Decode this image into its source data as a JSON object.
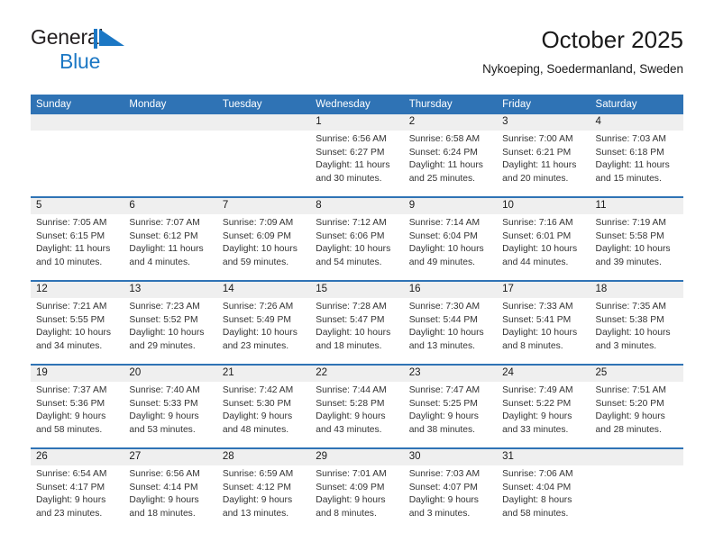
{
  "brand": {
    "name_top": "General",
    "name_bottom": "Blue",
    "flag_icon": "blue-triangle-flag",
    "accent_color": "#1b77c4"
  },
  "header": {
    "title": "October 2025",
    "subtitle": "Nykoeping, Soedermanland, Sweden"
  },
  "calendar": {
    "header_bg": "#2f73b5",
    "daynum_bg": "#efefef",
    "weekdays": [
      "Sunday",
      "Monday",
      "Tuesday",
      "Wednesday",
      "Thursday",
      "Friday",
      "Saturday"
    ],
    "weeks": [
      [
        {
          "day": "",
          "lines": []
        },
        {
          "day": "",
          "lines": []
        },
        {
          "day": "",
          "lines": []
        },
        {
          "day": "1",
          "lines": [
            "Sunrise: 6:56 AM",
            "Sunset: 6:27 PM",
            "Daylight: 11 hours",
            "and 30 minutes."
          ]
        },
        {
          "day": "2",
          "lines": [
            "Sunrise: 6:58 AM",
            "Sunset: 6:24 PM",
            "Daylight: 11 hours",
            "and 25 minutes."
          ]
        },
        {
          "day": "3",
          "lines": [
            "Sunrise: 7:00 AM",
            "Sunset: 6:21 PM",
            "Daylight: 11 hours",
            "and 20 minutes."
          ]
        },
        {
          "day": "4",
          "lines": [
            "Sunrise: 7:03 AM",
            "Sunset: 6:18 PM",
            "Daylight: 11 hours",
            "and 15 minutes."
          ]
        }
      ],
      [
        {
          "day": "5",
          "lines": [
            "Sunrise: 7:05 AM",
            "Sunset: 6:15 PM",
            "Daylight: 11 hours",
            "and 10 minutes."
          ]
        },
        {
          "day": "6",
          "lines": [
            "Sunrise: 7:07 AM",
            "Sunset: 6:12 PM",
            "Daylight: 11 hours",
            "and 4 minutes."
          ]
        },
        {
          "day": "7",
          "lines": [
            "Sunrise: 7:09 AM",
            "Sunset: 6:09 PM",
            "Daylight: 10 hours",
            "and 59 minutes."
          ]
        },
        {
          "day": "8",
          "lines": [
            "Sunrise: 7:12 AM",
            "Sunset: 6:06 PM",
            "Daylight: 10 hours",
            "and 54 minutes."
          ]
        },
        {
          "day": "9",
          "lines": [
            "Sunrise: 7:14 AM",
            "Sunset: 6:04 PM",
            "Daylight: 10 hours",
            "and 49 minutes."
          ]
        },
        {
          "day": "10",
          "lines": [
            "Sunrise: 7:16 AM",
            "Sunset: 6:01 PM",
            "Daylight: 10 hours",
            "and 44 minutes."
          ]
        },
        {
          "day": "11",
          "lines": [
            "Sunrise: 7:19 AM",
            "Sunset: 5:58 PM",
            "Daylight: 10 hours",
            "and 39 minutes."
          ]
        }
      ],
      [
        {
          "day": "12",
          "lines": [
            "Sunrise: 7:21 AM",
            "Sunset: 5:55 PM",
            "Daylight: 10 hours",
            "and 34 minutes."
          ]
        },
        {
          "day": "13",
          "lines": [
            "Sunrise: 7:23 AM",
            "Sunset: 5:52 PM",
            "Daylight: 10 hours",
            "and 29 minutes."
          ]
        },
        {
          "day": "14",
          "lines": [
            "Sunrise: 7:26 AM",
            "Sunset: 5:49 PM",
            "Daylight: 10 hours",
            "and 23 minutes."
          ]
        },
        {
          "day": "15",
          "lines": [
            "Sunrise: 7:28 AM",
            "Sunset: 5:47 PM",
            "Daylight: 10 hours",
            "and 18 minutes."
          ]
        },
        {
          "day": "16",
          "lines": [
            "Sunrise: 7:30 AM",
            "Sunset: 5:44 PM",
            "Daylight: 10 hours",
            "and 13 minutes."
          ]
        },
        {
          "day": "17",
          "lines": [
            "Sunrise: 7:33 AM",
            "Sunset: 5:41 PM",
            "Daylight: 10 hours",
            "and 8 minutes."
          ]
        },
        {
          "day": "18",
          "lines": [
            "Sunrise: 7:35 AM",
            "Sunset: 5:38 PM",
            "Daylight: 10 hours",
            "and 3 minutes."
          ]
        }
      ],
      [
        {
          "day": "19",
          "lines": [
            "Sunrise: 7:37 AM",
            "Sunset: 5:36 PM",
            "Daylight: 9 hours",
            "and 58 minutes."
          ]
        },
        {
          "day": "20",
          "lines": [
            "Sunrise: 7:40 AM",
            "Sunset: 5:33 PM",
            "Daylight: 9 hours",
            "and 53 minutes."
          ]
        },
        {
          "day": "21",
          "lines": [
            "Sunrise: 7:42 AM",
            "Sunset: 5:30 PM",
            "Daylight: 9 hours",
            "and 48 minutes."
          ]
        },
        {
          "day": "22",
          "lines": [
            "Sunrise: 7:44 AM",
            "Sunset: 5:28 PM",
            "Daylight: 9 hours",
            "and 43 minutes."
          ]
        },
        {
          "day": "23",
          "lines": [
            "Sunrise: 7:47 AM",
            "Sunset: 5:25 PM",
            "Daylight: 9 hours",
            "and 38 minutes."
          ]
        },
        {
          "day": "24",
          "lines": [
            "Sunrise: 7:49 AM",
            "Sunset: 5:22 PM",
            "Daylight: 9 hours",
            "and 33 minutes."
          ]
        },
        {
          "day": "25",
          "lines": [
            "Sunrise: 7:51 AM",
            "Sunset: 5:20 PM",
            "Daylight: 9 hours",
            "and 28 minutes."
          ]
        }
      ],
      [
        {
          "day": "26",
          "lines": [
            "Sunrise: 6:54 AM",
            "Sunset: 4:17 PM",
            "Daylight: 9 hours",
            "and 23 minutes."
          ]
        },
        {
          "day": "27",
          "lines": [
            "Sunrise: 6:56 AM",
            "Sunset: 4:14 PM",
            "Daylight: 9 hours",
            "and 18 minutes."
          ]
        },
        {
          "day": "28",
          "lines": [
            "Sunrise: 6:59 AM",
            "Sunset: 4:12 PM",
            "Daylight: 9 hours",
            "and 13 minutes."
          ]
        },
        {
          "day": "29",
          "lines": [
            "Sunrise: 7:01 AM",
            "Sunset: 4:09 PM",
            "Daylight: 9 hours",
            "and 8 minutes."
          ]
        },
        {
          "day": "30",
          "lines": [
            "Sunrise: 7:03 AM",
            "Sunset: 4:07 PM",
            "Daylight: 9 hours",
            "and 3 minutes."
          ]
        },
        {
          "day": "31",
          "lines": [
            "Sunrise: 7:06 AM",
            "Sunset: 4:04 PM",
            "Daylight: 8 hours",
            "and 58 minutes."
          ]
        },
        {
          "day": "",
          "lines": []
        }
      ]
    ]
  }
}
